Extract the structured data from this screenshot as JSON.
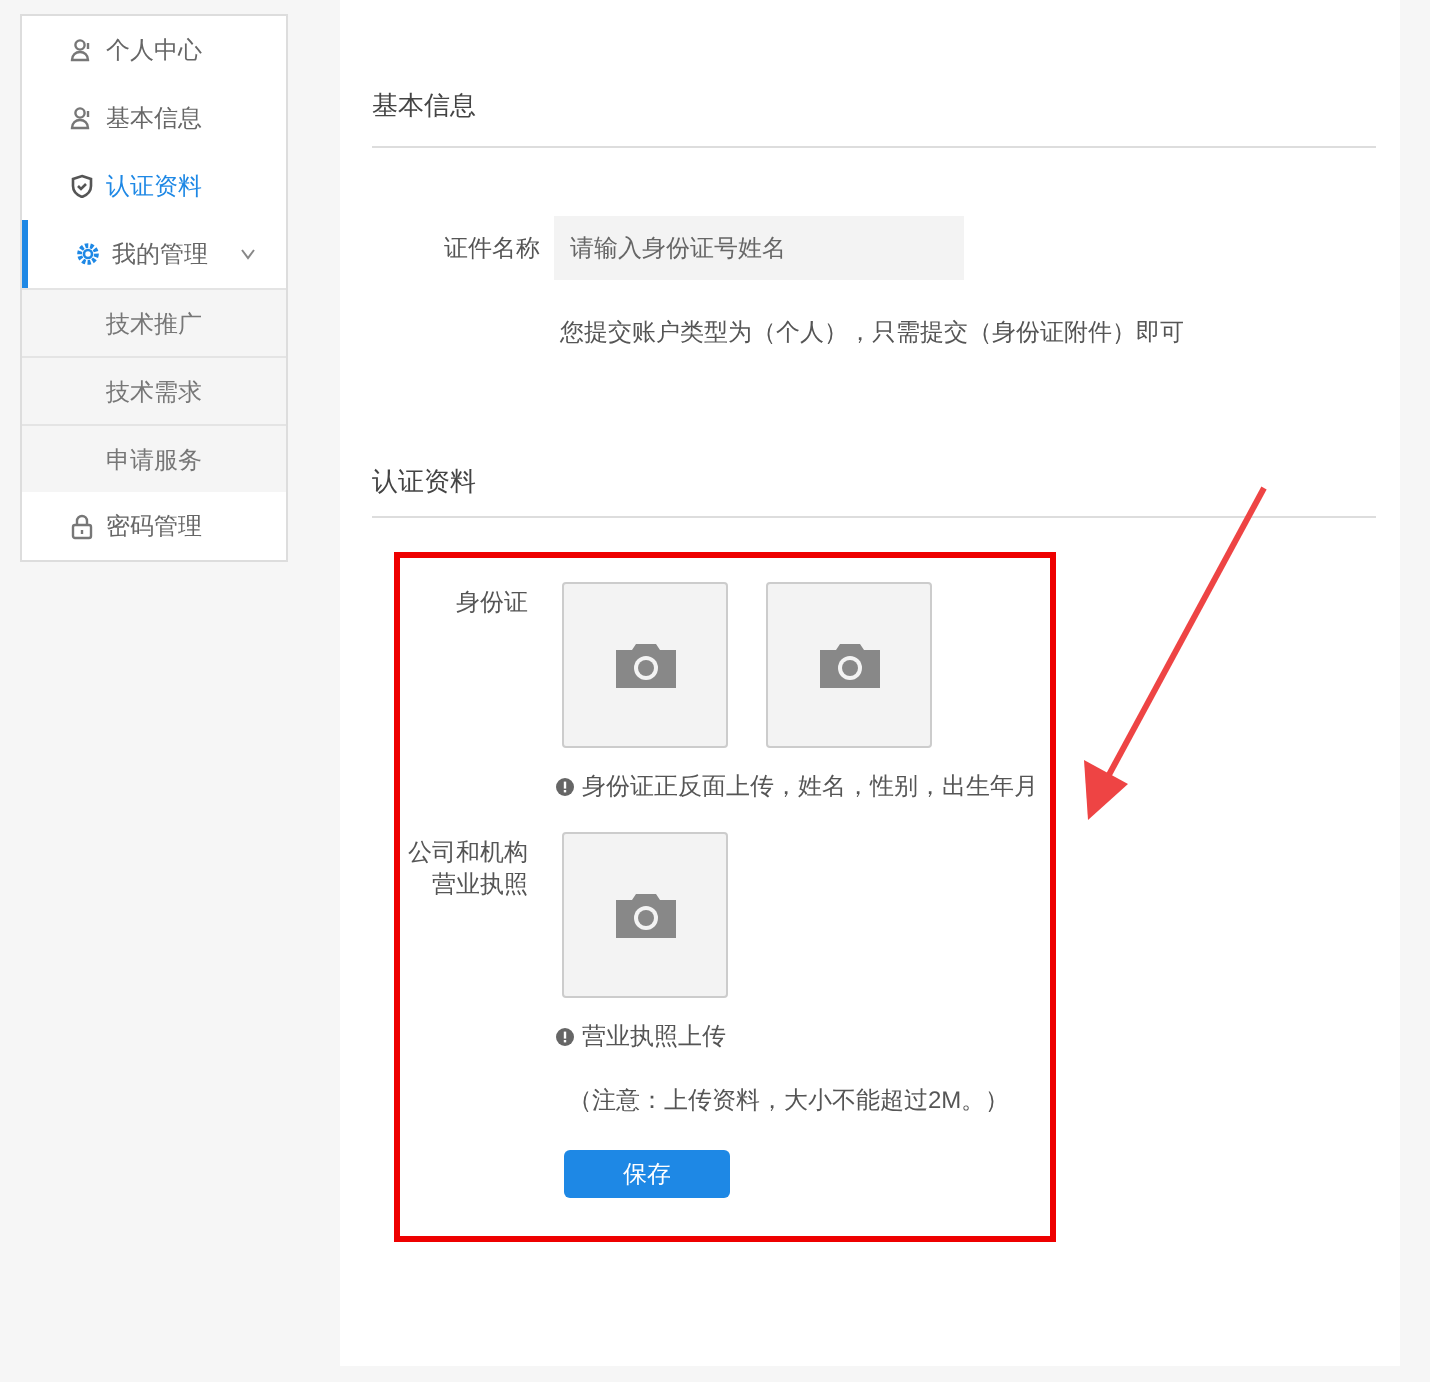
{
  "sidebar": {
    "items": [
      {
        "label": "个人中心",
        "kind": "item",
        "selected": false,
        "highlighted": false
      },
      {
        "label": "基本信息",
        "kind": "item",
        "selected": false,
        "highlighted": false
      },
      {
        "label": "认证资料",
        "kind": "item",
        "selected": true,
        "highlighted": false
      },
      {
        "label": "我的管理",
        "kind": "group",
        "selected": false,
        "highlighted": true,
        "expanded": true,
        "children": [
          {
            "label": "技术推广"
          },
          {
            "label": "技术需求"
          },
          {
            "label": "申请服务"
          }
        ]
      },
      {
        "label": "密码管理",
        "kind": "item",
        "selected": false,
        "highlighted": false
      }
    ]
  },
  "basic_info": {
    "title": "基本信息",
    "field_label": "证件名称",
    "placeholder": "请输入身份证号姓名",
    "hint": "您提交账户类型为（个人），只需提交（身份证附件）即可"
  },
  "certification": {
    "title": "认证资料",
    "groups": [
      {
        "label": [
          "身份证"
        ],
        "slots": [
          {
            "kind": "camera"
          },
          {
            "kind": "camera"
          }
        ],
        "note": "身份证正反面上传，姓名，性别，出生年月"
      },
      {
        "label": [
          "公司和机构",
          "营业执照"
        ],
        "slots": [
          {
            "kind": "camera"
          }
        ],
        "note": "营业执照上传"
      }
    ],
    "notice": "（注意：上传资料，大小不能超过2M。）",
    "save_button": "保存"
  }
}
